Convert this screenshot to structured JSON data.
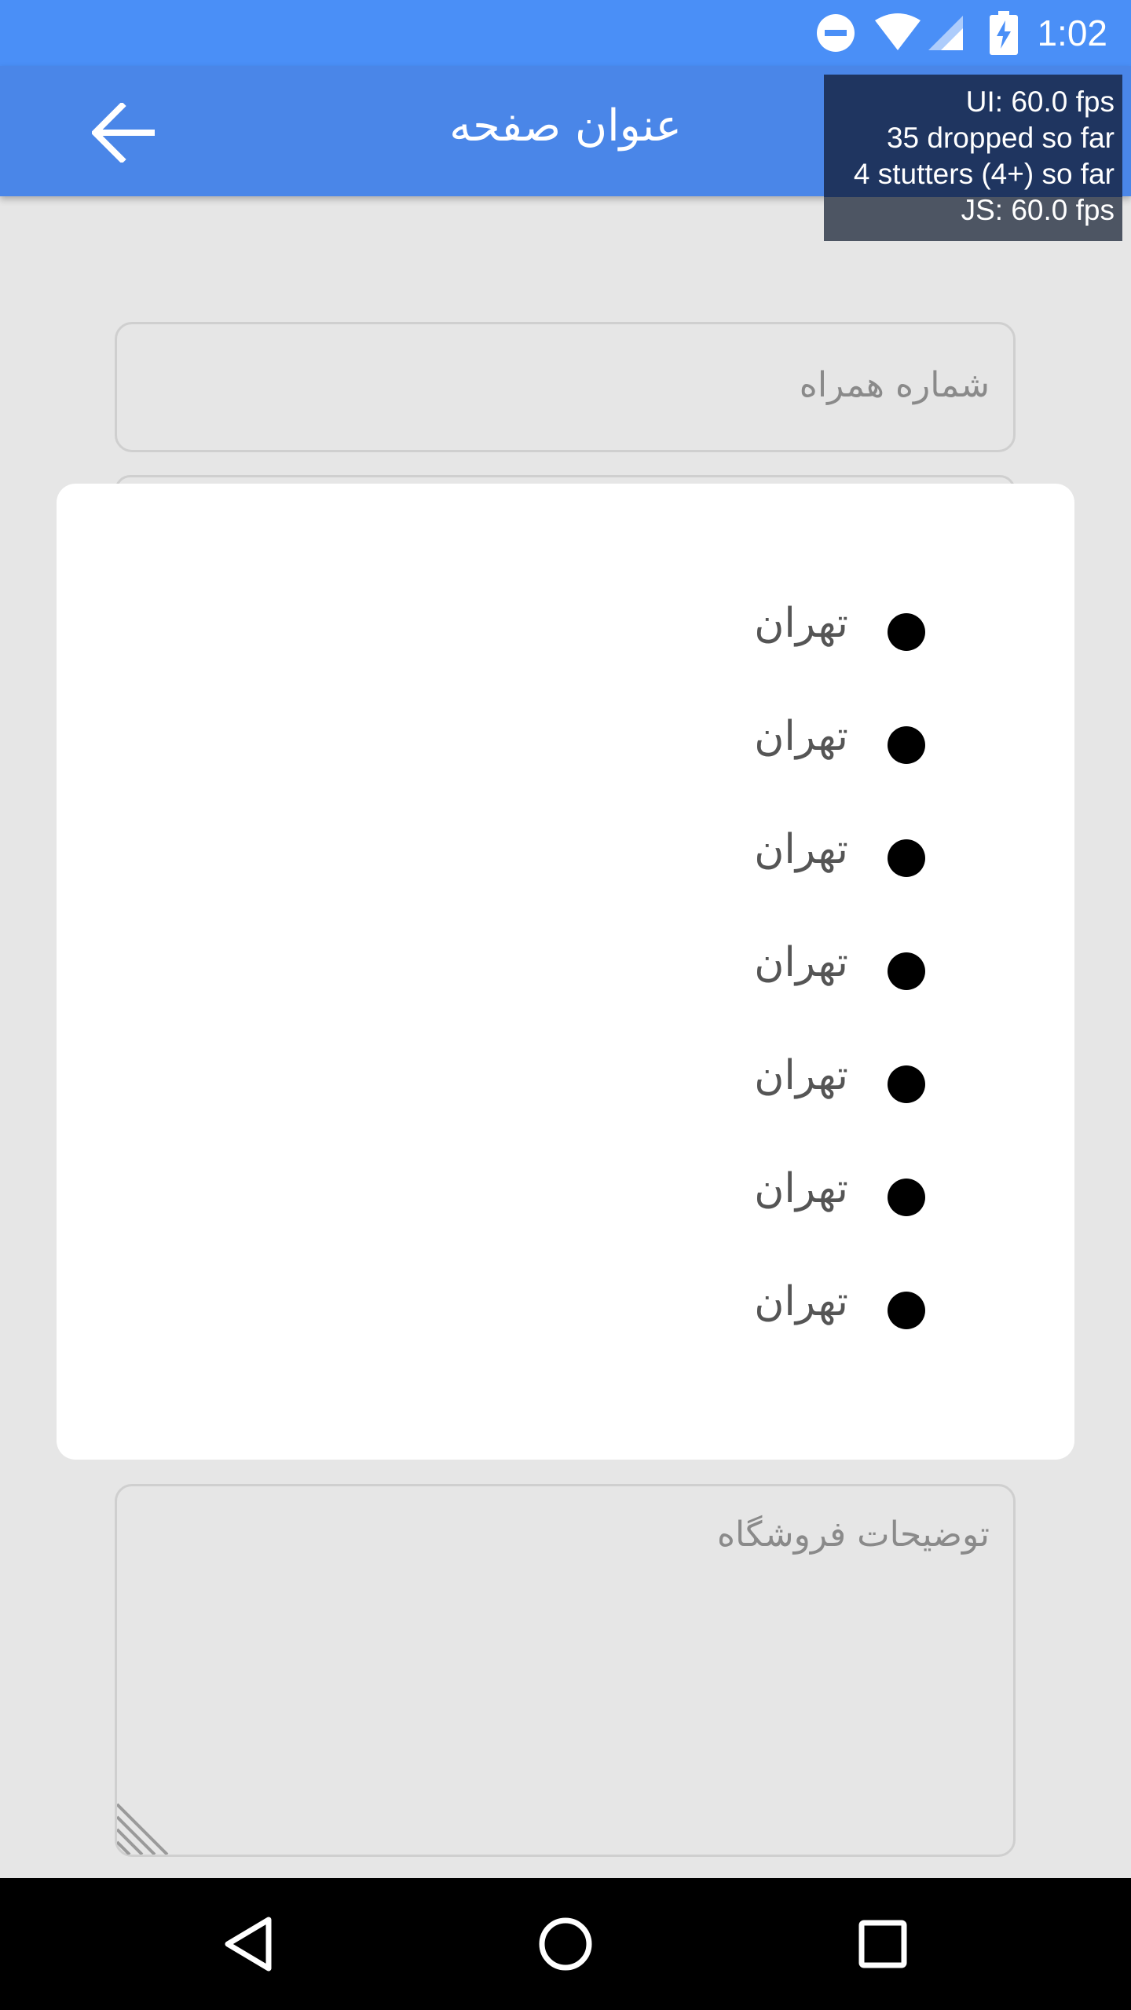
{
  "status_bar": {
    "time": "1:02",
    "icons": [
      "do-not-disturb-icon",
      "wifi-icon",
      "signal-icon",
      "battery-charging-icon"
    ],
    "background": "#4a8ff7"
  },
  "app_bar": {
    "title": "عنوان صفحه",
    "back_icon": "arrow-back-icon",
    "background": "#4a86e8"
  },
  "perf_overlay": {
    "lines": [
      "UI: 60.0 fps",
      "35 dropped so far",
      "4 stutters (4+) so far",
      "JS: 60.0 fps"
    ]
  },
  "form": {
    "phone_placeholder": "شماره همراه",
    "description_placeholder": "توضیحات فروشگاه"
  },
  "picker": {
    "items": [
      "تهران",
      "تهران",
      "تهران",
      "تهران",
      "تهران",
      "تهران",
      "تهران"
    ]
  },
  "nav_bar": {
    "icons": [
      "nav-back-icon",
      "nav-home-icon",
      "nav-recents-icon"
    ]
  }
}
